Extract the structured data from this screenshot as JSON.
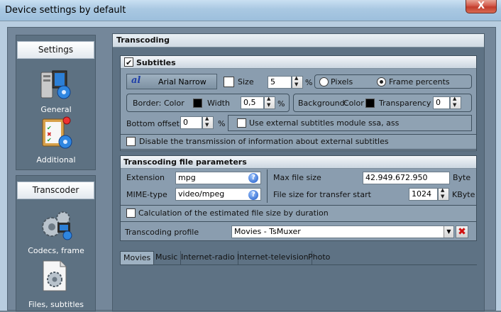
{
  "window": {
    "title": "Device settings by default",
    "close_label": "X"
  },
  "nav": {
    "settings_group": {
      "header": "Settings",
      "items": [
        {
          "label": "General",
          "icon": "general-settings-icon"
        },
        {
          "label": "Additional",
          "icon": "additional-settings-icon"
        }
      ]
    },
    "transcoder_group": {
      "header": "Transcoder",
      "items": [
        {
          "label": "Codecs, frame",
          "icon": "codecs-gear-icon"
        },
        {
          "label": "Files, subtitles",
          "icon": "files-gear-icon"
        }
      ]
    }
  },
  "main": {
    "title": "Transcoding",
    "subtitles": {
      "title": "Subtitles",
      "enabled": true,
      "font_button": "Arial Narrow",
      "font_icon_text": "al",
      "size_label": "Size",
      "size_checked": false,
      "size_value": "5",
      "size_unit": "%",
      "unit_options": [
        {
          "label": "Pixels",
          "selected": false
        },
        {
          "label": "Frame percents",
          "selected": true
        }
      ],
      "border": {
        "label": "Border:",
        "color_label": "Color",
        "color": "#000000",
        "width_label": "Width",
        "width_value": "0,5",
        "width_unit": "%"
      },
      "background": {
        "label": "Background:",
        "color_label": "Color",
        "color": "#000000",
        "transparency_label": "Transparency",
        "transparency_value": "0"
      },
      "bottom_offset_label": "Bottom offset",
      "bottom_offset_value": "0",
      "bottom_offset_unit": "%",
      "use_external_label": "Use external subtitles module ssa, ass",
      "use_external_checked": false,
      "disable_transmission_label": "Disable the transmission of information about external subtitles",
      "disable_transmission_checked": false
    },
    "file_params": {
      "title": "Transcoding file parameters",
      "extension_label": "Extension",
      "extension_value": "mpg",
      "mime_label": "MIME-type",
      "mime_value": "video/mpeg",
      "max_file_size_label": "Max file size",
      "max_file_size_value": "42.949.672.950",
      "max_file_size_unit": "Byte",
      "transfer_start_label": "File size for transfer start",
      "transfer_start_value": "1024",
      "transfer_start_unit": "KByte",
      "calc_estimated_label": "Calculation of the estimated file size by duration",
      "calc_estimated_checked": false,
      "profile_label": "Transcoding profile",
      "profile_value": "Movies - TsMuxer"
    },
    "tabs": [
      "Movies",
      "Music",
      "Internet-radio",
      "Internet-television",
      "Photo"
    ],
    "active_tab": "Movies"
  }
}
